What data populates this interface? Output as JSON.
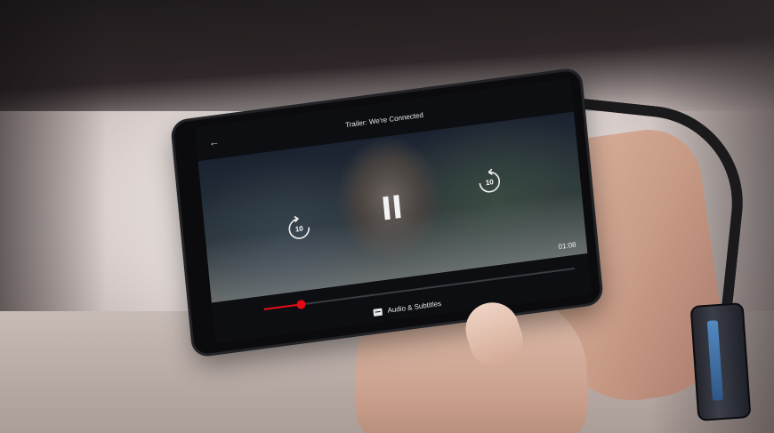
{
  "player": {
    "title": "Trailer: We're Connected",
    "back_icon": "arrow-left-icon",
    "rewind_icon": "replay-10-icon",
    "rewind_seconds": "10",
    "forward_icon": "forward-10-icon",
    "forward_seconds": "10",
    "play_state_icon": "pause-icon",
    "time_remaining": "01:08",
    "progress_fraction": 0.12,
    "audio_subtitles_icon": "subtitles-icon",
    "audio_subtitles_label": "Audio & Subtitles",
    "accent_color": "#e50914"
  }
}
